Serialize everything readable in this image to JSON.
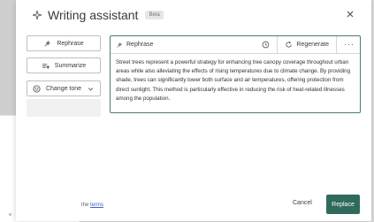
{
  "dialog": {
    "title": "Writing assistant",
    "badge": "Beta",
    "close_icon": "close-icon"
  },
  "sidebar": {
    "rephrase": "Rephrase",
    "summarize": "Summarize",
    "change_tone": "Change tone"
  },
  "panel": {
    "title": "Rephrase",
    "regenerate": "Regenerate",
    "more": "···",
    "text": "Street trees represent a powerful strategy for enhancing tree canopy coverage throughout urban areas while also alleviating the effects of rising temperatures due to climate change. By providing shade, trees can significantly lower both surface and air temperatures, offering protection from direct sunlight. This method is particularly effective in reducing the risk of heat-related illnesses among the population."
  },
  "footer": {
    "terms_prefix": "the",
    "terms_link": "terms",
    "cancel": "Cancel",
    "replace": "Replace"
  },
  "colors": {
    "accent": "#2f6b5b",
    "panel_border": "#4b7c6f"
  }
}
